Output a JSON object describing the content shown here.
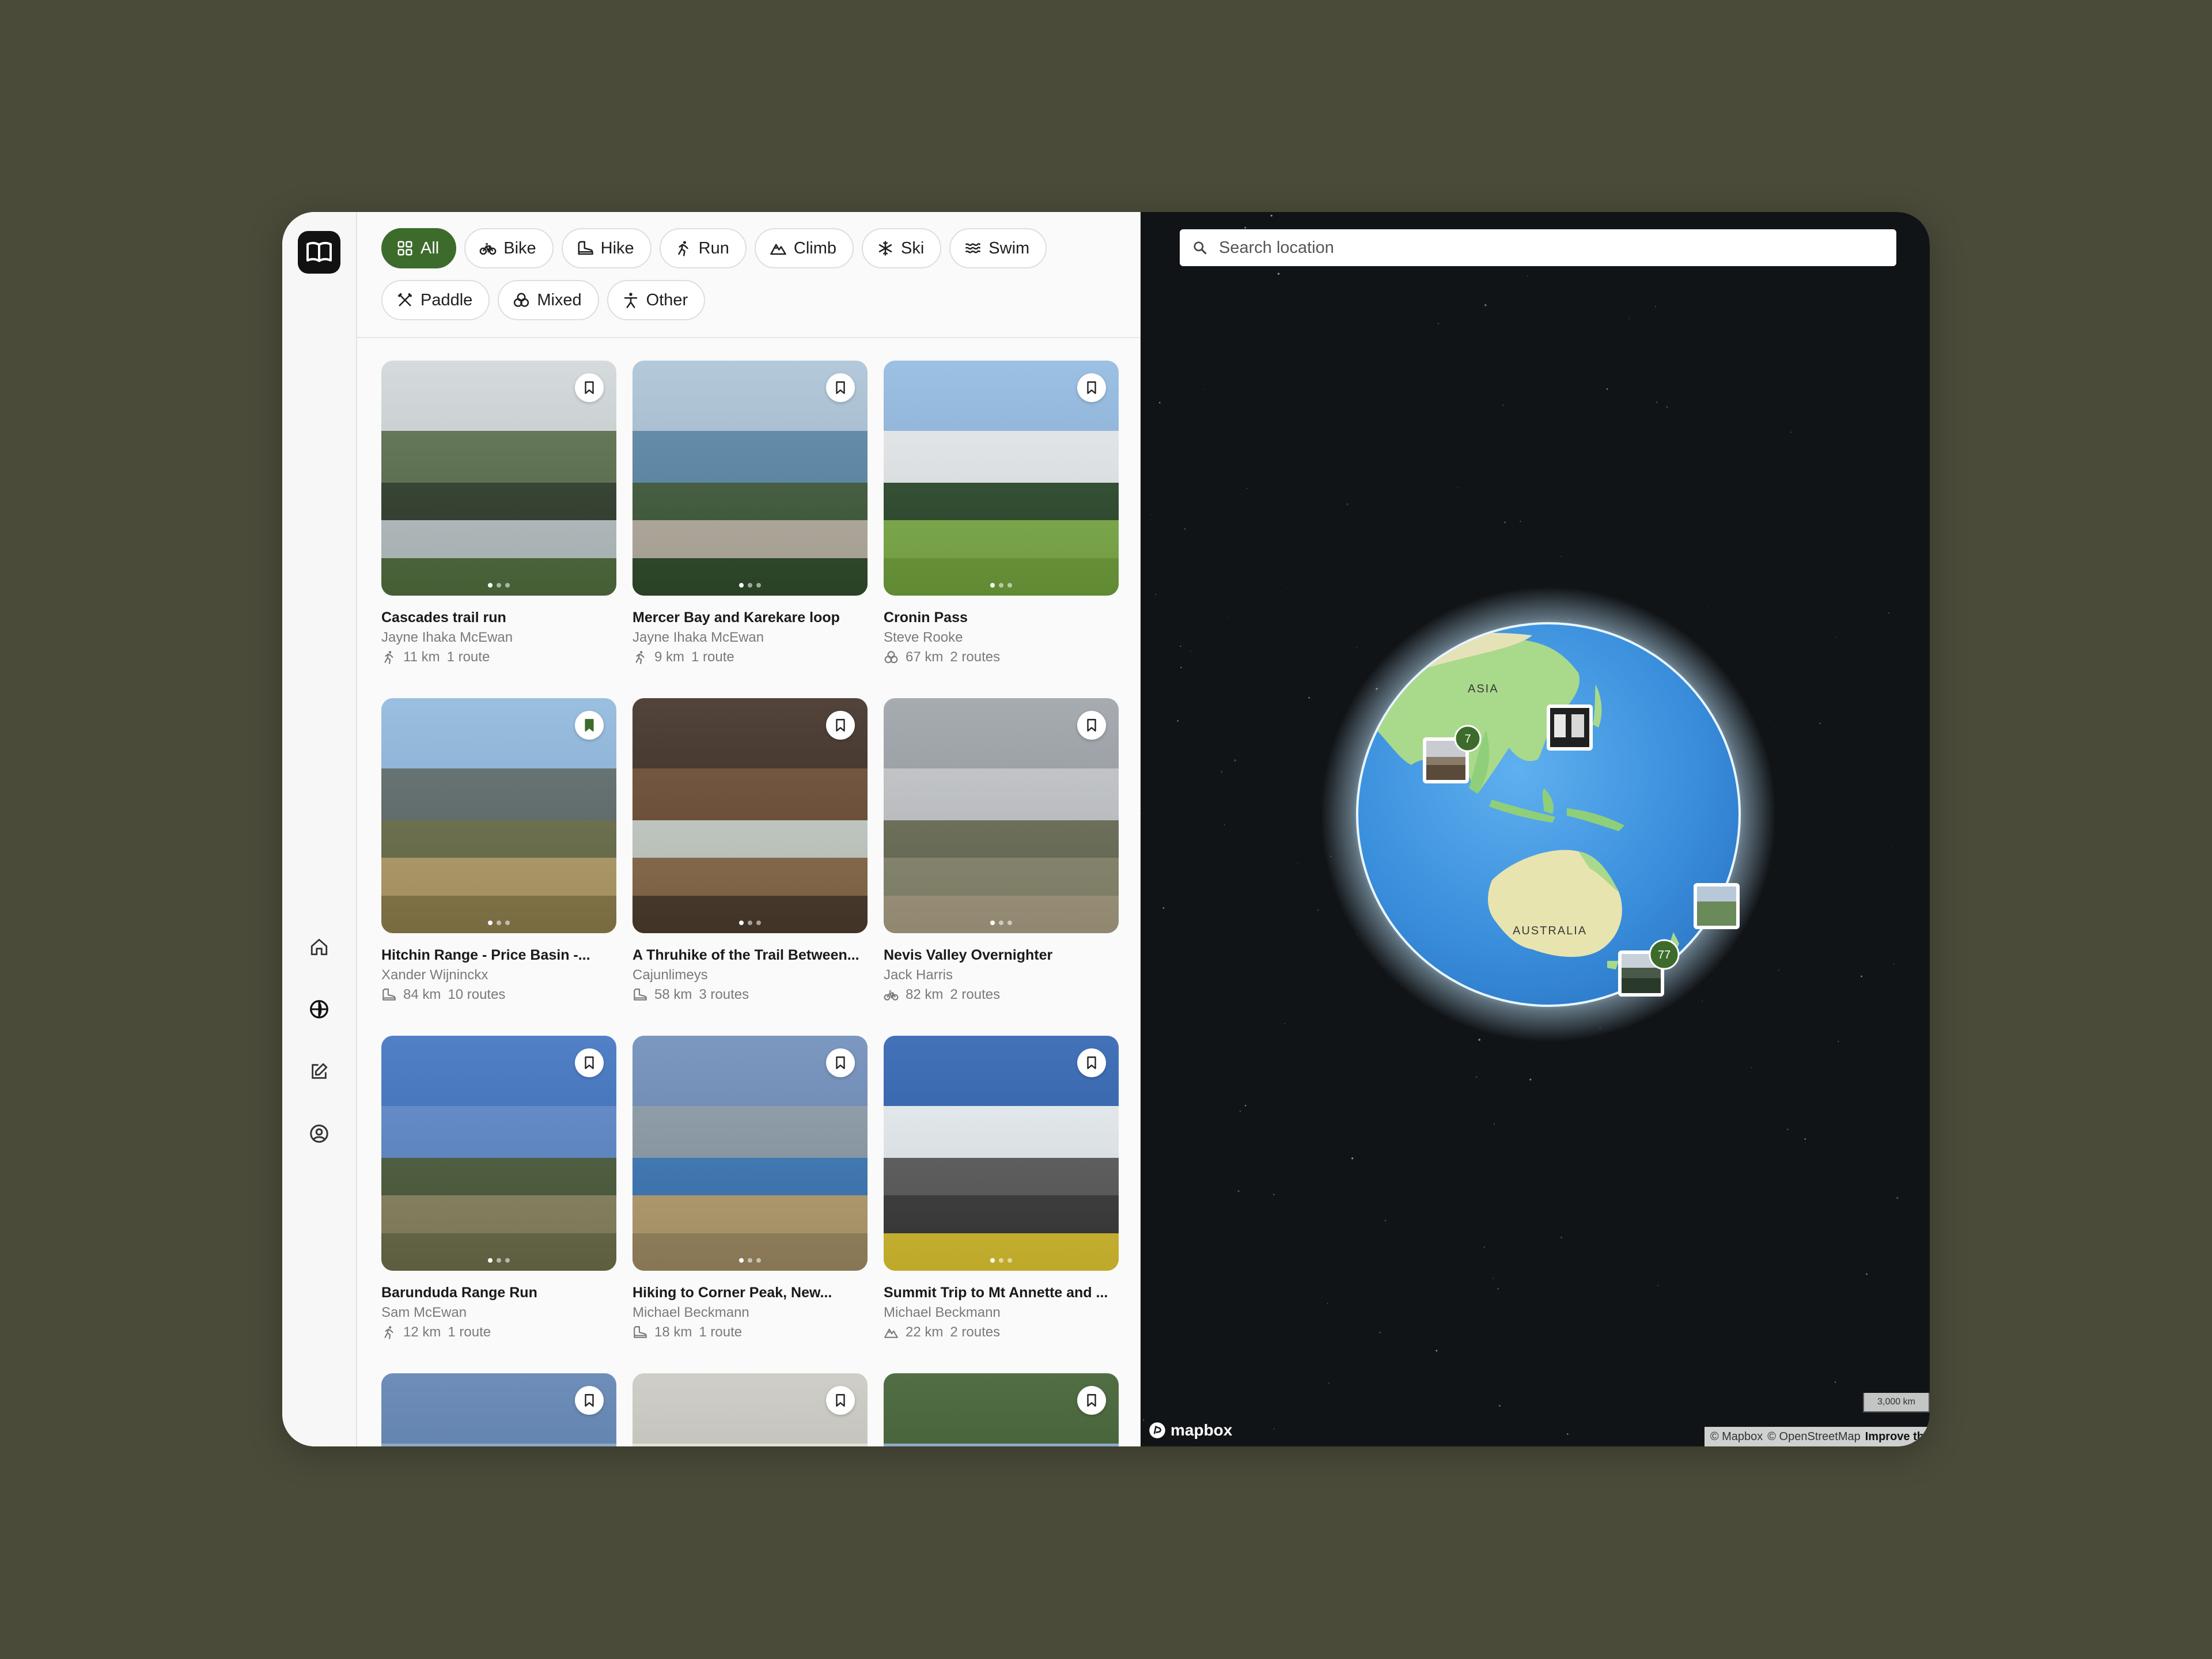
{
  "app": {
    "logo_icon": "book-icon"
  },
  "sidebar": {
    "items": [
      {
        "name": "home",
        "icon": "home-icon"
      },
      {
        "name": "explore",
        "icon": "globe-icon"
      },
      {
        "name": "create",
        "icon": "edit-icon"
      },
      {
        "name": "profile",
        "icon": "user-icon"
      }
    ]
  },
  "filters": [
    {
      "label": "All",
      "icon": "grid-icon",
      "active": true
    },
    {
      "label": "Bike",
      "icon": "bike-icon"
    },
    {
      "label": "Hike",
      "icon": "boot-icon"
    },
    {
      "label": "Run",
      "icon": "run-icon"
    },
    {
      "label": "Climb",
      "icon": "mountain-icon"
    },
    {
      "label": "Ski",
      "icon": "snowflake-icon"
    },
    {
      "label": "Swim",
      "icon": "waves-icon"
    },
    {
      "label": "Paddle",
      "icon": "paddle-icon"
    },
    {
      "label": "Mixed",
      "icon": "mixed-icon"
    },
    {
      "label": "Other",
      "icon": "person-icon"
    }
  ],
  "trips": [
    {
      "title": "Cascades trail run",
      "author": "Jayne Ihaka McEwan",
      "distance": "11 km",
      "routes": "1 route",
      "activity_icon": "run-icon",
      "bookmarked": false,
      "palette": [
        "#cfd6d8",
        "#5b6f4d",
        "#2f3d2c",
        "#b9c4c6",
        "#4e6b3c"
      ]
    },
    {
      "title": "Mercer Bay and Karekare loop",
      "author": "Jayne Ihaka McEwan",
      "distance": "9 km",
      "routes": "1 route",
      "activity_icon": "run-icon",
      "bookmarked": false,
      "palette": [
        "#a9c2d6",
        "#5a87a8",
        "#3f5a3a",
        "#b8b0a2",
        "#2f4a2a"
      ]
    },
    {
      "title": "Cronin Pass",
      "author": "Steve Rooke",
      "distance": "67 km",
      "routes": "2 routes",
      "activity_icon": "mixed-icon",
      "bookmarked": false,
      "palette": [
        "#8fb8e0",
        "#e8ecef",
        "#2b4a2b",
        "#7fb04a",
        "#6e9d3a"
      ]
    },
    {
      "title": "Hitchin Range - Price Basin -...",
      "author": "Xander Wijninckx",
      "distance": "84 km",
      "routes": "10 routes",
      "activity_icon": "boot-icon",
      "bookmarked": true,
      "palette": [
        "#8cb6dc",
        "#5d6b6a",
        "#6b6f4a",
        "#b5a06a",
        "#8a7a4a"
      ]
    },
    {
      "title": "A Thruhike of the Trail Between...",
      "author": "Cajunlimeys",
      "distance": "58 km",
      "routes": "3 routes",
      "activity_icon": "boot-icon",
      "bookmarked": false,
      "palette": [
        "#3a2a20",
        "#6a4a30",
        "#c7cfc8",
        "#8a6a4a",
        "#4a3a2a"
      ]
    },
    {
      "title": "Nevis Valley Overnighter",
      "author": "Jack Harris",
      "distance": "82 km",
      "routes": "2 routes",
      "activity_icon": "bike-icon",
      "bookmarked": false,
      "palette": [
        "#9aa0a6",
        "#c3c6c9",
        "#6a6e56",
        "#8a8a70",
        "#a59a80"
      ]
    },
    {
      "title": "Barunduda Range Run",
      "author": "Sam McEwan",
      "distance": "12 km",
      "routes": "1 route",
      "activity_icon": "run-icon",
      "bookmarked": false,
      "palette": [
        "#3a6fc0",
        "#5a86c8",
        "#4a5a3a",
        "#8a8460",
        "#6a6a48"
      ]
    },
    {
      "title": "Hiking to Corner Peak, New...",
      "author": "Michael Beckmann",
      "distance": "18 km",
      "routes": "1 route",
      "activity_icon": "boot-icon",
      "bookmarked": false,
      "palette": [
        "#6a8ab8",
        "#8a9aa8",
        "#3a78b8",
        "#b8a070",
        "#9a8660"
      ]
    },
    {
      "title": "Summit Trip to Mt Annette and ...",
      "author": "Michael Beckmann",
      "distance": "22 km",
      "routes": "2 routes",
      "activity_icon": "mountain-icon",
      "bookmarked": false,
      "palette": [
        "#2a5fb0",
        "#e8eef2",
        "#5a5a5a",
        "#3a3a3a",
        "#d8c030"
      ]
    },
    {
      "title": "",
      "author": "",
      "distance": "",
      "routes": "",
      "activity_icon": "",
      "bookmarked": false,
      "palette": [
        "#5a7fb0",
        "#8aa8c8",
        "#aac0d8",
        "#c8d4e0",
        "#d8e0e8"
      ]
    },
    {
      "title": "",
      "author": "",
      "distance": "",
      "routes": "",
      "activity_icon": "",
      "bookmarked": false,
      "palette": [
        "#c8c8c0",
        "#e8e8e0",
        "#f8f8f0",
        "#b8b8b0",
        "#a8a8a0"
      ]
    },
    {
      "title": "",
      "author": "",
      "distance": "",
      "routes": "",
      "activity_icon": "",
      "bookmarked": false,
      "palette": [
        "#3a5a2a",
        "#8aa8c8",
        "#5a7a3a",
        "#2a4a20",
        "#c8d8e8"
      ]
    }
  ],
  "map": {
    "search_placeholder": "Search location",
    "labels": {
      "asia": "ASIA",
      "australia": "AUSTRALIA"
    },
    "clusters": [
      {
        "count": "7"
      },
      {
        "count": "77"
      }
    ],
    "scale": "3,000 km",
    "logo": "mapbox",
    "attribution": {
      "mapbox": "© Mapbox",
      "osm": "© OpenStreetMap",
      "improve": "Improve th"
    }
  },
  "colors": {
    "accent": "#3d6b2c",
    "page_bg": "#4a4b39",
    "map_bg": "#111417"
  }
}
